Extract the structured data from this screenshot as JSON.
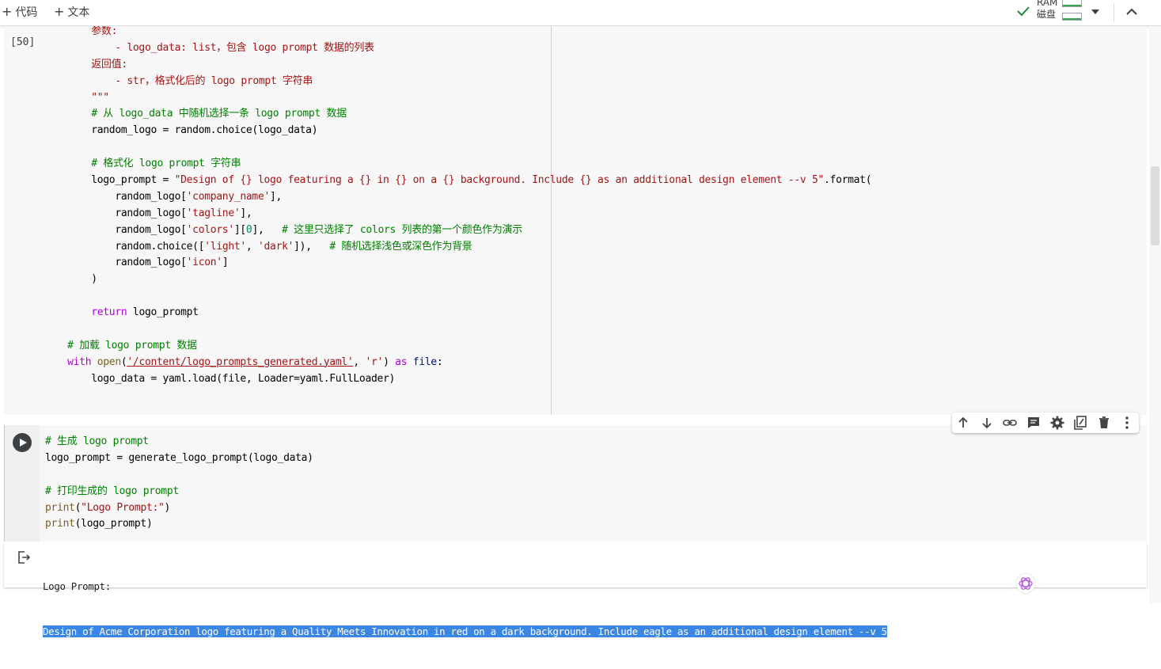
{
  "toolbar": {
    "add_code_label": "代码",
    "add_text_label": "文本",
    "ram_label": "RAM",
    "disk_label": "磁盘",
    "check_color": "#1e8e3e"
  },
  "cell1": {
    "exec_count": "[50]",
    "lines": [
      [
        {
          "t": "        "
        },
        {
          "t": "参数:",
          "c": "str"
        }
      ],
      [
        {
          "t": "            "
        },
        {
          "t": "- logo_data: list，包含 logo prompt 数据的列表",
          "c": "str"
        }
      ],
      [
        {
          "t": "        "
        },
        {
          "t": "返回值:",
          "c": "str"
        }
      ],
      [
        {
          "t": "            "
        },
        {
          "t": "- str，格式化后的 logo prompt 字符串",
          "c": "str"
        }
      ],
      [
        {
          "t": "        "
        },
        {
          "t": "\"\"\"",
          "c": "str"
        }
      ],
      [
        {
          "t": "        "
        },
        {
          "t": "# 从 logo_data 中随机选择一条 logo prompt 数据",
          "c": "cmt"
        }
      ],
      [
        {
          "t": "        random_logo = random.choice(logo_data)"
        }
      ],
      [
        {
          "t": ""
        }
      ],
      [
        {
          "t": "        "
        },
        {
          "t": "# 格式化 logo prompt 字符串",
          "c": "cmt"
        }
      ],
      [
        {
          "t": "        logo_prompt = "
        },
        {
          "t": "\"Design of {} logo featuring a {} in {} on a {} background. Include {} as an additional design element --v 5\"",
          "c": "str"
        },
        {
          "t": ".format("
        }
      ],
      [
        {
          "t": "            random_logo["
        },
        {
          "t": "'company_name'",
          "c": "str"
        },
        {
          "t": "],"
        }
      ],
      [
        {
          "t": "            random_logo["
        },
        {
          "t": "'tagline'",
          "c": "str"
        },
        {
          "t": "],"
        }
      ],
      [
        {
          "t": "            random_logo["
        },
        {
          "t": "'colors'",
          "c": "str"
        },
        {
          "t": "]["
        },
        {
          "t": "0",
          "c": "num"
        },
        {
          "t": "],   "
        },
        {
          "t": "# 这里只选择了 colors 列表的第一个颜色作为演示",
          "c": "cmt"
        }
      ],
      [
        {
          "t": "            random.choice(["
        },
        {
          "t": "'light'",
          "c": "str"
        },
        {
          "t": ", "
        },
        {
          "t": "'dark'",
          "c": "str"
        },
        {
          "t": "]),   "
        },
        {
          "t": "# 随机选择浅色或深色作为背景",
          "c": "cmt"
        }
      ],
      [
        {
          "t": "            random_logo["
        },
        {
          "t": "'icon'",
          "c": "str"
        },
        {
          "t": "]"
        }
      ],
      [
        {
          "t": "        )"
        }
      ],
      [
        {
          "t": ""
        }
      ],
      [
        {
          "t": "        "
        },
        {
          "t": "return",
          "c": "kw"
        },
        {
          "t": " logo_prompt"
        }
      ],
      [
        {
          "t": ""
        }
      ],
      [
        {
          "t": "    "
        },
        {
          "t": "# 加载 logo prompt 数据",
          "c": "cmt"
        }
      ],
      [
        {
          "t": "    "
        },
        {
          "t": "with",
          "c": "kw"
        },
        {
          "t": " "
        },
        {
          "t": "open",
          "c": "fn"
        },
        {
          "t": "("
        },
        {
          "t": "'/content/logo_prompts_generated.yaml'",
          "c": "link"
        },
        {
          "t": ", "
        },
        {
          "t": "'r'",
          "c": "str"
        },
        {
          "t": ") "
        },
        {
          "t": "as",
          "c": "kw"
        },
        {
          "t": " "
        },
        {
          "t": "file",
          "c": "var"
        },
        {
          "t": ":"
        }
      ],
      [
        {
          "t": "        logo_data = yaml.load(file, Loader=yaml.FullLoader)"
        }
      ]
    ]
  },
  "cell2": {
    "lines": [
      [
        {
          "t": "# 生成 logo prompt",
          "c": "cmt"
        }
      ],
      [
        {
          "t": "logo_prompt = generate_logo_prompt(logo_data)"
        }
      ],
      [
        {
          "t": ""
        }
      ],
      [
        {
          "t": "# 打印生成的 logo prompt",
          "c": "cmt"
        }
      ],
      [
        {
          "t": "print",
          "c": "fn"
        },
        {
          "t": "("
        },
        {
          "t": "\"Logo Prompt:\"",
          "c": "str"
        },
        {
          "t": ")"
        }
      ],
      [
        {
          "t": "print",
          "c": "fn"
        },
        {
          "t": "(logo_prompt)"
        }
      ]
    ]
  },
  "cell_toolbar": {
    "icons": [
      "move-up-icon",
      "move-down-icon",
      "link-icon",
      "comment-icon",
      "settings-icon",
      "mirror-cell-icon",
      "delete-icon",
      "more-options-icon"
    ]
  },
  "output": {
    "line1": "Logo Prompt:",
    "line2": "Design of Acme Corporation logo featuring a Quality Meets Innovation in red on a dark background. Include eagle as an additional design element --v 5",
    "selection_color": "#3b86e3"
  }
}
